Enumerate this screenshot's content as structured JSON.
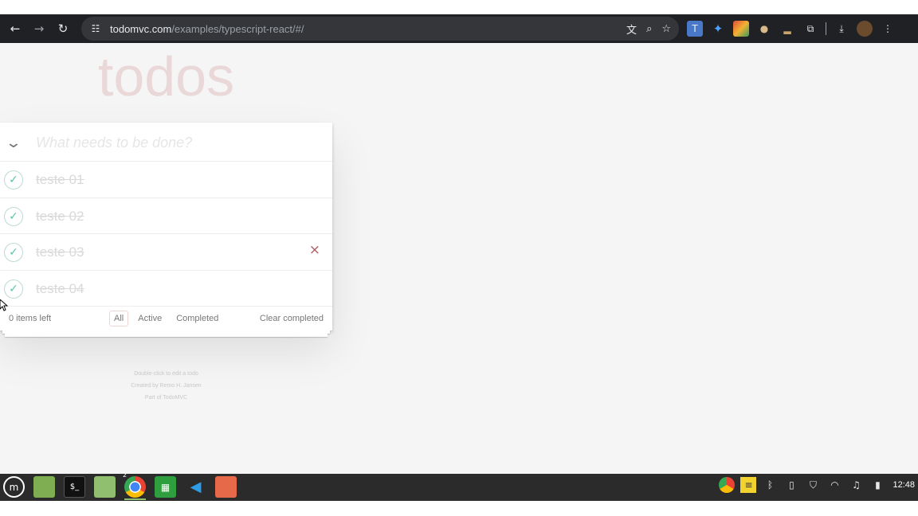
{
  "browser": {
    "url_host": "todomvc.com",
    "url_path": "/examples/typescript-react/#/",
    "back_icon": "←",
    "forward_icon": "→",
    "reload_icon": "↻",
    "site_info_icon": "☷",
    "translate_icon": "文",
    "zoom_icon": "⌕",
    "bookmark_icon": "☆",
    "extensions_icon": "⧉",
    "download_icon": "⤓",
    "menu_icon": "⋮"
  },
  "app": {
    "title": "todos",
    "new_todo_placeholder": "What needs to be done?",
    "toggle_all_icon": "⌵",
    "todos": [
      {
        "title": "teste 01",
        "completed": true
      },
      {
        "title": "teste 02",
        "completed": true
      },
      {
        "title": "teste 03",
        "completed": true,
        "hovered": true
      },
      {
        "title": "teste 04",
        "completed": true
      }
    ],
    "check_icon": "✓",
    "destroy_icon": "×",
    "footer": {
      "items_left": "0 items left",
      "filters": [
        "All",
        "Active",
        "Completed"
      ],
      "selected_filter": "All",
      "clear_completed": "Clear completed"
    },
    "info": {
      "line1": "Double-click to edit a todo",
      "line2": "Created by Remo H. Jansen",
      "line3": "Part of TodoMVC"
    }
  },
  "taskbar": {
    "clock": "12:48",
    "chrome_badge": "2"
  }
}
